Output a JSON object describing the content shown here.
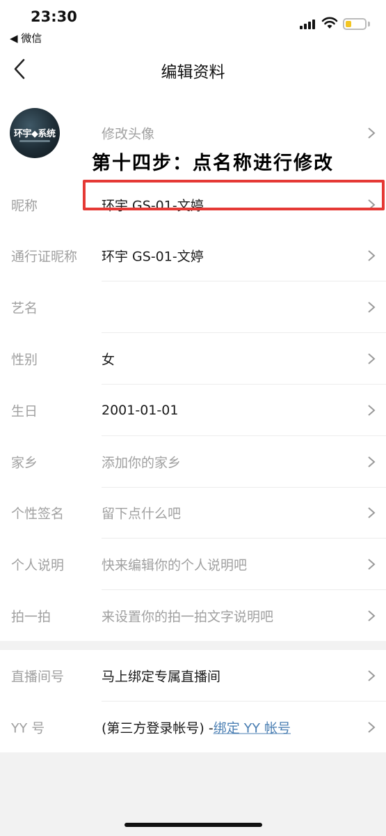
{
  "status_bar": {
    "time": "23:30",
    "back_app_label": "◀ 微信",
    "battery_color": "#f3c623"
  },
  "nav": {
    "title": "编辑资料",
    "back_icon": "chevron-left-icon"
  },
  "profile": {
    "avatar_text": "环宇◆系统",
    "avatar_action_label": "修改头像",
    "rows": [
      {
        "label": "昵称",
        "value": "环宇 GS-01-文婷"
      },
      {
        "label": "通行证昵称",
        "value": "环宇 GS-01-文婷"
      },
      {
        "label": "艺名",
        "value": ""
      },
      {
        "label": "性别",
        "value": "女"
      },
      {
        "label": "生日",
        "value": "2001-01-01"
      },
      {
        "label": "家乡",
        "placeholder": "添加你的家乡"
      },
      {
        "label": "个性签名",
        "placeholder": "留下点什么吧"
      },
      {
        "label": "个人说明",
        "placeholder": "快来编辑你的个人说明吧"
      },
      {
        "label": "拍一拍",
        "placeholder": "来设置你的拍一拍文字说明吧"
      }
    ]
  },
  "bindings": {
    "rows": [
      {
        "label": "直播间号",
        "value": "马上绑定专属直播间"
      },
      {
        "label": "YY 号",
        "value_prefix": "(第三方登录帐号) -",
        "link_text": "绑定 YY 帐号"
      }
    ]
  },
  "annotation": {
    "text": "第十四步：点名称进行修改",
    "highlight_color": "#e53935"
  }
}
